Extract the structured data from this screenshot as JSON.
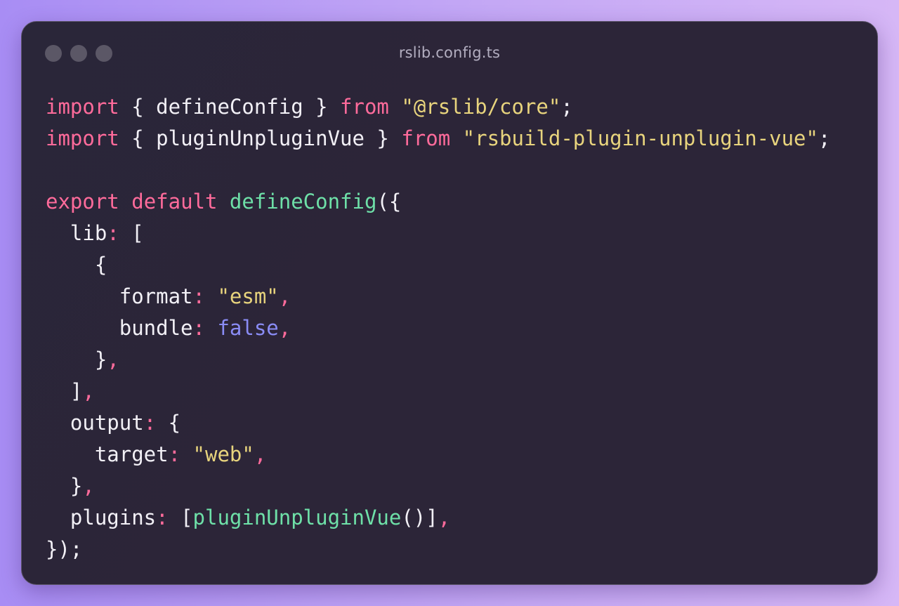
{
  "window": {
    "title": "rslib.config.ts",
    "controls": [
      "window-dot",
      "window-dot",
      "window-dot"
    ]
  },
  "colors": {
    "keyword": "#ff6b9b",
    "string": "#e8d47d",
    "function": "#6ee0a8",
    "boolean": "#8a8cf5",
    "text": "#f2f0f6",
    "background": "#2c2538"
  },
  "code": {
    "lines": [
      [
        {
          "t": "kw",
          "v": "import"
        },
        {
          "t": "plain",
          "v": " { defineConfig } "
        },
        {
          "t": "kw",
          "v": "from"
        },
        {
          "t": "plain",
          "v": " "
        },
        {
          "t": "str",
          "v": "\"@rslib/core\""
        },
        {
          "t": "plain",
          "v": ";"
        }
      ],
      [
        {
          "t": "kw",
          "v": "import"
        },
        {
          "t": "plain",
          "v": " { pluginUnpluginVue } "
        },
        {
          "t": "kw",
          "v": "from"
        },
        {
          "t": "plain",
          "v": " "
        },
        {
          "t": "str",
          "v": "\"rsbuild-plugin-unplugin-vue\""
        },
        {
          "t": "plain",
          "v": ";"
        }
      ],
      [],
      [
        {
          "t": "kw",
          "v": "export"
        },
        {
          "t": "plain",
          "v": " "
        },
        {
          "t": "kw",
          "v": "default"
        },
        {
          "t": "plain",
          "v": " "
        },
        {
          "t": "fn",
          "v": "defineConfig"
        },
        {
          "t": "plain",
          "v": "({"
        }
      ],
      [
        {
          "t": "plain",
          "v": "  lib"
        },
        {
          "t": "punc",
          "v": ":"
        },
        {
          "t": "plain",
          "v": " ["
        }
      ],
      [
        {
          "t": "plain",
          "v": "    {"
        }
      ],
      [
        {
          "t": "plain",
          "v": "      format"
        },
        {
          "t": "punc",
          "v": ":"
        },
        {
          "t": "plain",
          "v": " "
        },
        {
          "t": "str",
          "v": "\"esm\""
        },
        {
          "t": "punc",
          "v": ","
        }
      ],
      [
        {
          "t": "plain",
          "v": "      bundle"
        },
        {
          "t": "punc",
          "v": ":"
        },
        {
          "t": "plain",
          "v": " "
        },
        {
          "t": "bool",
          "v": "false"
        },
        {
          "t": "punc",
          "v": ","
        }
      ],
      [
        {
          "t": "plain",
          "v": "    }"
        },
        {
          "t": "punc",
          "v": ","
        }
      ],
      [
        {
          "t": "plain",
          "v": "  ]"
        },
        {
          "t": "punc",
          "v": ","
        }
      ],
      [
        {
          "t": "plain",
          "v": "  output"
        },
        {
          "t": "punc",
          "v": ":"
        },
        {
          "t": "plain",
          "v": " {"
        }
      ],
      [
        {
          "t": "plain",
          "v": "    target"
        },
        {
          "t": "punc",
          "v": ":"
        },
        {
          "t": "plain",
          "v": " "
        },
        {
          "t": "str",
          "v": "\"web\""
        },
        {
          "t": "punc",
          "v": ","
        }
      ],
      [
        {
          "t": "plain",
          "v": "  }"
        },
        {
          "t": "punc",
          "v": ","
        }
      ],
      [
        {
          "t": "plain",
          "v": "  plugins"
        },
        {
          "t": "punc",
          "v": ":"
        },
        {
          "t": "plain",
          "v": " ["
        },
        {
          "t": "fn",
          "v": "pluginUnpluginVue"
        },
        {
          "t": "plain",
          "v": "()]"
        },
        {
          "t": "punc",
          "v": ","
        }
      ],
      [
        {
          "t": "plain",
          "v": "});"
        }
      ]
    ]
  }
}
